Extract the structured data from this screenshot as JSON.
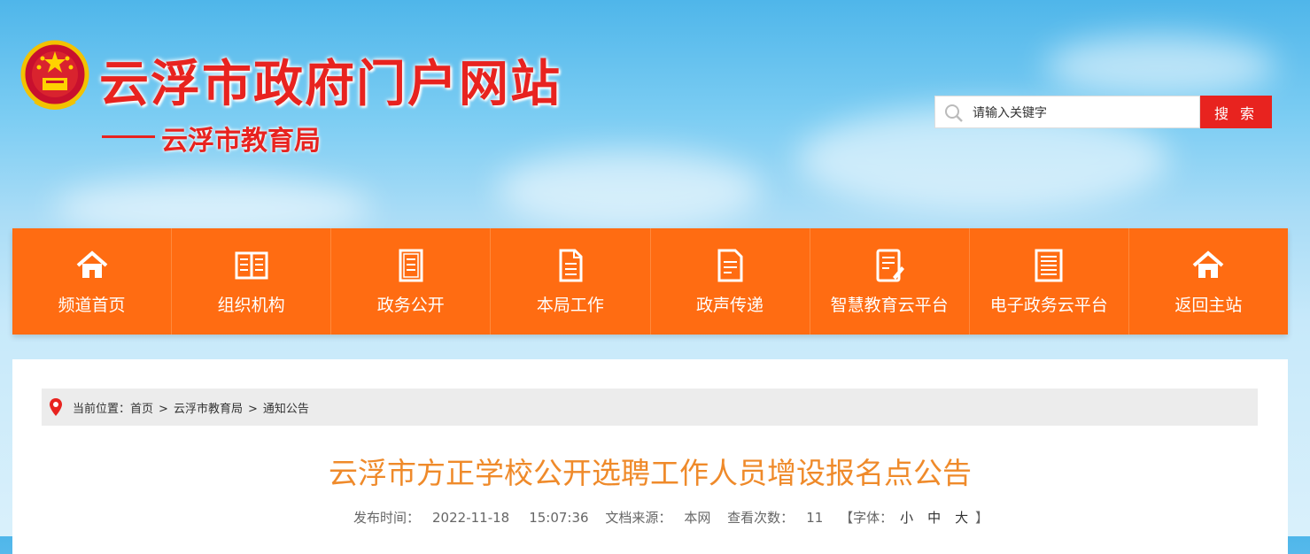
{
  "header": {
    "site_title": "云浮市政府门户网站",
    "sub_title": "云浮市教育局",
    "search": {
      "placeholder": "请输入关键字",
      "button_label": "搜 索"
    }
  },
  "nav": {
    "items": [
      {
        "label": "频道首页",
        "icon": "home-icon"
      },
      {
        "label": "组织机构",
        "icon": "book-icon"
      },
      {
        "label": "政务公开",
        "icon": "document-icon"
      },
      {
        "label": "本局工作",
        "icon": "file-icon"
      },
      {
        "label": "政声传递",
        "icon": "notes-icon"
      },
      {
        "label": "智慧教育云平台",
        "icon": "edit-document-icon"
      },
      {
        "label": "电子政务云平台",
        "icon": "list-document-icon"
      },
      {
        "label": "返回主站",
        "icon": "home-icon"
      }
    ]
  },
  "breadcrumb": {
    "prefix": "当前位置：",
    "items": [
      "首页",
      "云浮市教育局",
      "通知公告"
    ],
    "separator": ">"
  },
  "article": {
    "title": "云浮市方正学校公开选聘工作人员增设报名点公告",
    "publish_label": "发布时间：",
    "publish_date": "2022-11-18",
    "publish_time": "15:07:36",
    "source_label": "文档来源：",
    "source": "本网",
    "views_label": "查看次数：",
    "views": "11",
    "font_label": "【字体：",
    "font_small": "小",
    "font_medium": "中",
    "font_large": "大",
    "font_close": "】"
  },
  "colors": {
    "brand_red": "#e8231f",
    "nav_orange": "#ff6c12",
    "title_orange": "#ef8a2a"
  }
}
